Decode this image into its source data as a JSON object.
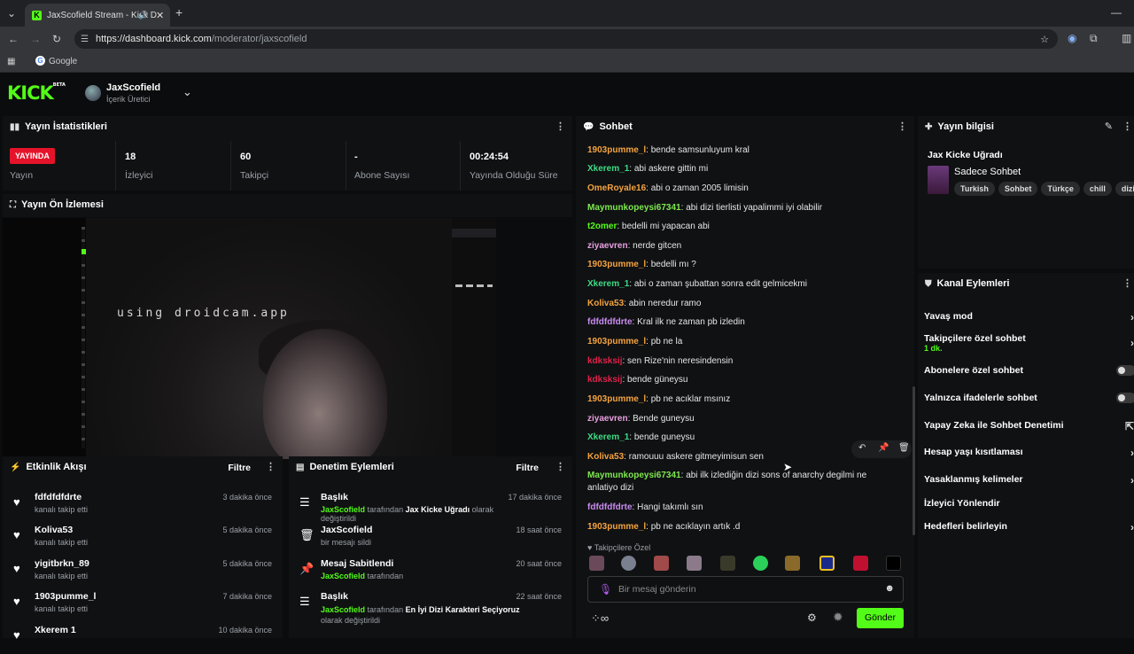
{
  "browser": {
    "tab_title": "JaxScofield Stream - Kick D",
    "url_prefix": "https://dashboard.kick.com",
    "url_path": "/moderator/jaxscofield",
    "bookmark": "Google"
  },
  "header": {
    "logo": "KICK",
    "logo_badge": "BETA",
    "user_name": "JaxScofield",
    "user_role": "İçerik Üretici"
  },
  "stats": {
    "title": "Yayın İstatistikleri",
    "live_badge": "YAYINDA",
    "live_label": "Yayın",
    "viewers_value": "18",
    "viewers_label": "İzleyici",
    "followers_value": "60",
    "followers_label": "Takipçi",
    "subs_value": "-",
    "subs_label": "Abone Sayısı",
    "uptime_value": "00:24:54",
    "uptime_label": "Yayında Olduğu Süre"
  },
  "preview": {
    "title": "Yayın Ön İzlemesi",
    "overlay_text": "using droidcam.app"
  },
  "activity": {
    "title": "Etkinlik Akışı",
    "filter": "Filtre",
    "items": [
      {
        "name": "fdfdfdfdrte",
        "sub": "kanalı takip etti",
        "when": "3 dakika önce"
      },
      {
        "name": "Koliva53",
        "sub": "kanalı takip etti",
        "when": "5 dakika önce"
      },
      {
        "name": "yigitbrkn_89",
        "sub": "kanalı takip etti",
        "when": "5 dakika önce"
      },
      {
        "name": "1903pumme_l",
        "sub": "kanalı takip etti",
        "when": "7 dakika önce"
      },
      {
        "name": "Xkerem 1",
        "sub": "",
        "when": "10 dakika önce"
      }
    ]
  },
  "moderation": {
    "title": "Denetim Eylemleri",
    "filter": "Filtre",
    "items": [
      {
        "title": "Başlık",
        "actor": "JaxScofield",
        "mid": "tarafından",
        "target": "Jax Kicke Uğradı",
        "tail": "olarak değiştirildi",
        "when": "17 dakika önce"
      },
      {
        "title": "JaxScofield",
        "actor": "",
        "mid": "bir mesajı sildi",
        "target": "",
        "tail": "",
        "when": "18 saat önce"
      },
      {
        "title": "Mesaj Sabitlendi",
        "actor": "JaxScofield",
        "mid": "tarafından",
        "target": "",
        "tail": "",
        "when": "20 saat önce"
      },
      {
        "title": "Başlık",
        "actor": "JaxScofield",
        "mid": "tarafından",
        "target": "En İyi Dizi Karakteri Seçiyoruz",
        "tail": "olarak değiştirildi",
        "when": "22 saat önce"
      }
    ]
  },
  "chat": {
    "title": "Sohbet",
    "messages": [
      {
        "user": "1903pumme_l",
        "color": "#f4a340",
        "text": "bende samsunluyum kral"
      },
      {
        "user": "Xkerem_1",
        "color": "#3ddc84",
        "text": "abi askere gittin mi"
      },
      {
        "user": "OmeRoyale16",
        "color": "#f4a340",
        "text": "abi o zaman 2005 limisin"
      },
      {
        "user": "Maymunkopeysi67341",
        "color": "#7ee84f",
        "text": "abi dizi tierlisti yapalimmi iyi olabilir"
      },
      {
        "user": "t2omer",
        "color": "#53fc18",
        "text": "bedelli mi yapacan abi"
      },
      {
        "user": "ziyaevren",
        "color": "#e8a0e0",
        "text": "nerde gitcen"
      },
      {
        "user": "1903pumme_l",
        "color": "#f4a340",
        "text": "bedelli mı ?"
      },
      {
        "user": "Xkerem_1",
        "color": "#3ddc84",
        "text": "abi o zaman şubattan sonra edit gelmicekmi"
      },
      {
        "user": "Koliva53",
        "color": "#f4a340",
        "text": "abin neredur ramo"
      },
      {
        "user": "fdfdfdfdrte",
        "color": "#c98cf0",
        "text": "Kral ilk ne zaman pb izledin"
      },
      {
        "user": "1903pumme_l",
        "color": "#f4a340",
        "text": "pb ne la"
      },
      {
        "user": "kdksksij",
        "color": "#e0224a",
        "text": "sen Rize'nin neresindensin"
      },
      {
        "user": "kdksksij",
        "color": "#e0224a",
        "text": "bende güneysu"
      },
      {
        "user": "1903pumme_l",
        "color": "#f4a340",
        "text": "pb ne acıklar msınız"
      },
      {
        "user": "ziyaevren",
        "color": "#e8a0e0",
        "text": "Bende guneysu"
      },
      {
        "user": "Xkerem_1",
        "color": "#3ddc84",
        "text": "bende guneysu"
      },
      {
        "user": "Koliva53",
        "color": "#f4a340",
        "text": "ramouuu askere gitmeyimisun sen"
      },
      {
        "user": "Maymunkopeysi67341",
        "color": "#7ee84f",
        "text": "abi ilk izlediğin dizi sons of anarchy degilmi ne anlatiyo dizi"
      },
      {
        "user": "fdfdfdfdrte",
        "color": "#c98cf0",
        "text": "Hangi takımlı sın"
      },
      {
        "user": "1903pumme_l",
        "color": "#f4a340",
        "text": "pb ne acıklayın artık .d"
      }
    ],
    "emote_section": "Takipçilere Özel",
    "input_placeholder": "Bir mesaj gönderin",
    "send_label": "Gönder"
  },
  "stream_info": {
    "title": "Yayın bilgisi",
    "stream_title": "Jax Kicke Uğradı",
    "category": "Sadece Sohbet",
    "tags": [
      "Turkish",
      "Sohbet",
      "Türkçe",
      "chill",
      "dizi"
    ]
  },
  "channel_actions": {
    "title": "Kanal Eylemleri",
    "slow_mode": "Yavaş mod",
    "followers_only": "Takipçilere özel sohbet",
    "followers_only_value": "1 dk.",
    "subs_only": "Abonelere özel sohbet",
    "emote_only": "Yalnızca ifadelerle sohbet",
    "ai_moderation": "Yapay Zeka ile Sohbet Denetimi",
    "age_restriction": "Hesap yaşı kısıtlaması",
    "banned_words": "Yasaklanmış kelimeler",
    "redirect": "İzleyici Yönlendir",
    "goals": "Hedefleri belirleyin"
  }
}
